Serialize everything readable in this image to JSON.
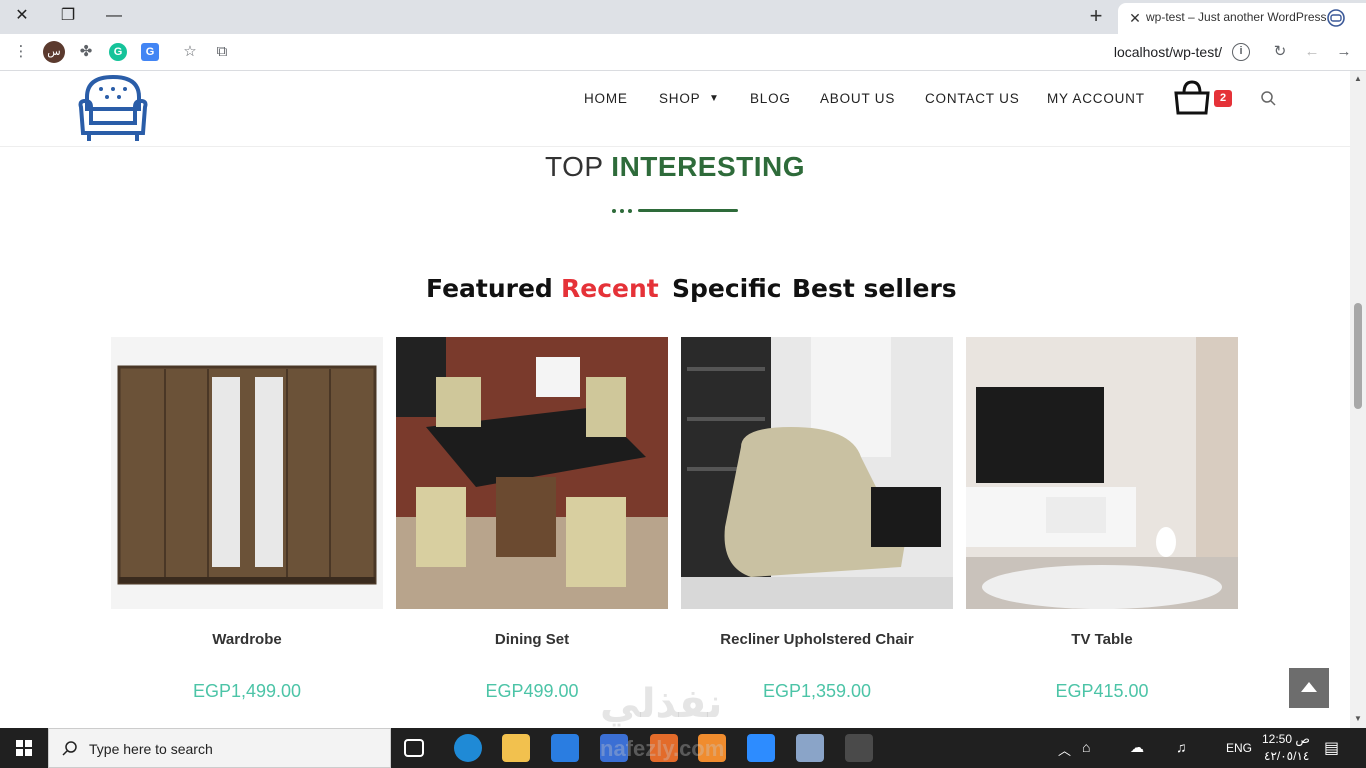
{
  "browser": {
    "tab_title": "wp-test – Just another WordPress",
    "url": "localhost/wp-test/",
    "new_tab_label": "+",
    "profile_initial": "س",
    "ext_grammarly": "G",
    "ext_translate": "G"
  },
  "site": {
    "nav": [
      "HOME",
      "SHOP",
      "BLOG",
      "ABOUT US",
      "CONTACT US",
      "MY ACCOUNT"
    ],
    "cart_count": "2",
    "section_title_plain": "TOP",
    "section_title_highlight": "INTERESTING",
    "product_tabs": [
      "Featured",
      "Recent",
      "Specific",
      "Best sellers"
    ],
    "active_tab": "Recent",
    "products": [
      {
        "name": "Wardrobe",
        "price": "EGP1,499.00"
      },
      {
        "name": "Dining Set",
        "price": "EGP499.00"
      },
      {
        "name": "Recliner Upholstered Chair",
        "price": "EGP1,359.00"
      },
      {
        "name": "TV Table",
        "price": "EGP415.00"
      }
    ],
    "watermark": "نفذلي"
  },
  "taskbar": {
    "search_placeholder": "Type here to search",
    "language": "ENG",
    "time": "12:50 ص",
    "date": "٤٢/٠٥/١٤",
    "watermark2": "nafezly.com"
  },
  "colors": {
    "accent_green": "#2e6b3a",
    "price_teal": "#4cc4a7",
    "active_red": "#e53238"
  }
}
